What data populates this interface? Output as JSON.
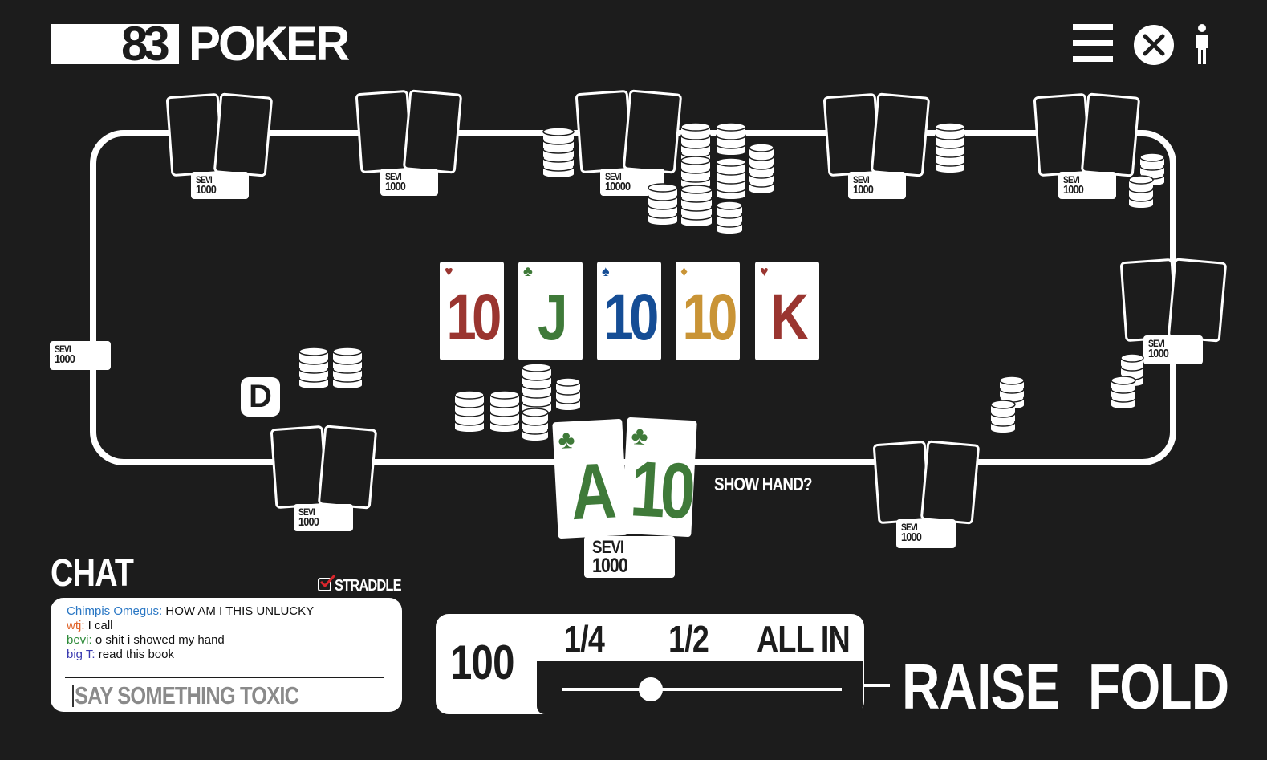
{
  "app": {
    "logo_number": "83",
    "logo_word": "POKER"
  },
  "colors": {
    "heart": "#9a3530",
    "club": "#3f7a39",
    "spade": "#154d95",
    "diamond": "#c99436",
    "background": "#1c1c1c"
  },
  "seats": [
    {
      "name": "SEVI",
      "stack": "1000"
    },
    {
      "name": "SEVI",
      "stack": "1000"
    },
    {
      "name": "SEVI",
      "stack": "10000"
    },
    {
      "name": "SEVI",
      "stack": "1000"
    },
    {
      "name": "SEVI",
      "stack": "1000"
    },
    {
      "name": "SEVI",
      "stack": "1000"
    },
    {
      "name": "SEVI",
      "stack": "1000"
    },
    {
      "name": "SEVI",
      "stack": "1000"
    },
    {
      "name": "SEVI",
      "stack": "1000"
    }
  ],
  "board": [
    {
      "rank": "10",
      "suit": "heart"
    },
    {
      "rank": "J",
      "suit": "club"
    },
    {
      "rank": "10",
      "suit": "spade"
    },
    {
      "rank": "10",
      "suit": "diamond"
    },
    {
      "rank": "K",
      "suit": "heart"
    }
  ],
  "dealer_button": "D",
  "hero": {
    "cards": [
      {
        "rank": "A",
        "suit": "club"
      },
      {
        "rank": "10",
        "suit": "club"
      }
    ],
    "name": "SEVI",
    "stack": "1000",
    "show_hand_label": "SHOW HAND?"
  },
  "chat": {
    "title": "CHAT",
    "straddle_label": "STRADDLE",
    "straddle_checked": true,
    "messages": [
      {
        "user": "Chimpis Omegus:",
        "text": " HOW AM I THIS UNLUCKY",
        "color": "#2a77c4"
      },
      {
        "user": "wtj:",
        "text": " I call",
        "color": "#e0642a"
      },
      {
        "user": "bevi:",
        "text": " o shit i showed my hand",
        "color": "#2e8b3a"
      },
      {
        "user": "big T:",
        "text": " read this book",
        "color": "#3a3ab0"
      }
    ],
    "input_placeholder": "SAY SOMETHING TOXIC"
  },
  "bet": {
    "amount": "100",
    "presets": [
      "1/4",
      "1/2",
      "ALL IN"
    ],
    "raise_label": "RAISE",
    "fold_label": "FOLD"
  }
}
